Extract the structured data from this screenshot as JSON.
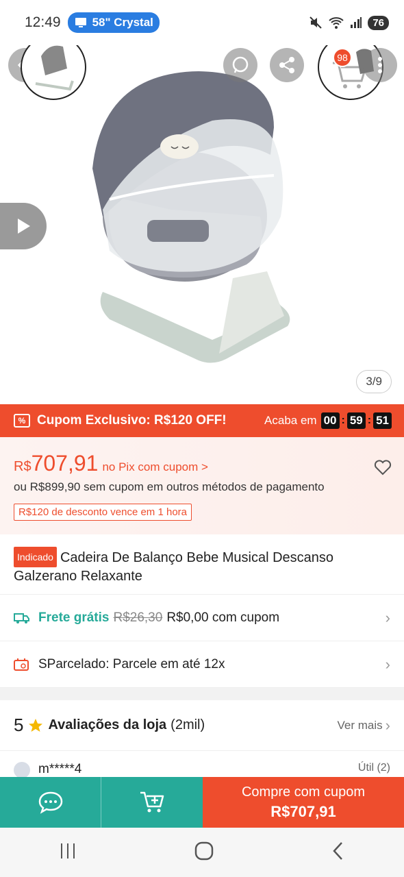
{
  "status_bar": {
    "time": "12:49",
    "cast_label": "58\" Crystal",
    "battery": "76"
  },
  "gallery": {
    "counter": "3/9",
    "cart_badge": "98"
  },
  "coupon_banner": {
    "title": "Cupom Exclusivo: R$120 OFF!",
    "ends_label": "Acaba em",
    "timer": {
      "hours": "00",
      "minutes": "59",
      "seconds": "51"
    }
  },
  "price": {
    "currency": "R$",
    "amount": "707,91",
    "pix_label": "no Pix com cupom >",
    "alt_price": "ou R$899,90 sem cupom em outros métodos de pagamento",
    "discount_tag": "R$120 de desconto vence em 1 hora"
  },
  "product": {
    "badge": "Indicado",
    "title": "Cadeira De Balanço Bebe Musical Descanso Galzerano Relaxante"
  },
  "shipping": {
    "free_label": "Frete grátis",
    "old_price": "R$26,30",
    "new_price": "R$0,00 com cupom"
  },
  "installments": {
    "label": "SParcelado: Parcele em até 12x"
  },
  "reviews": {
    "rating": "5",
    "title": "Avaliações da loja",
    "count": "(2mil)",
    "see_more": "Ver mais"
  },
  "review_peek": {
    "reviewer": "m*****4",
    "useful": "Útil (2)"
  },
  "action_bar": {
    "buy_label": "Compre com cupom",
    "buy_price": "R$707,91"
  },
  "colors": {
    "accent": "#ee4d2d",
    "teal": "#26aa99"
  }
}
